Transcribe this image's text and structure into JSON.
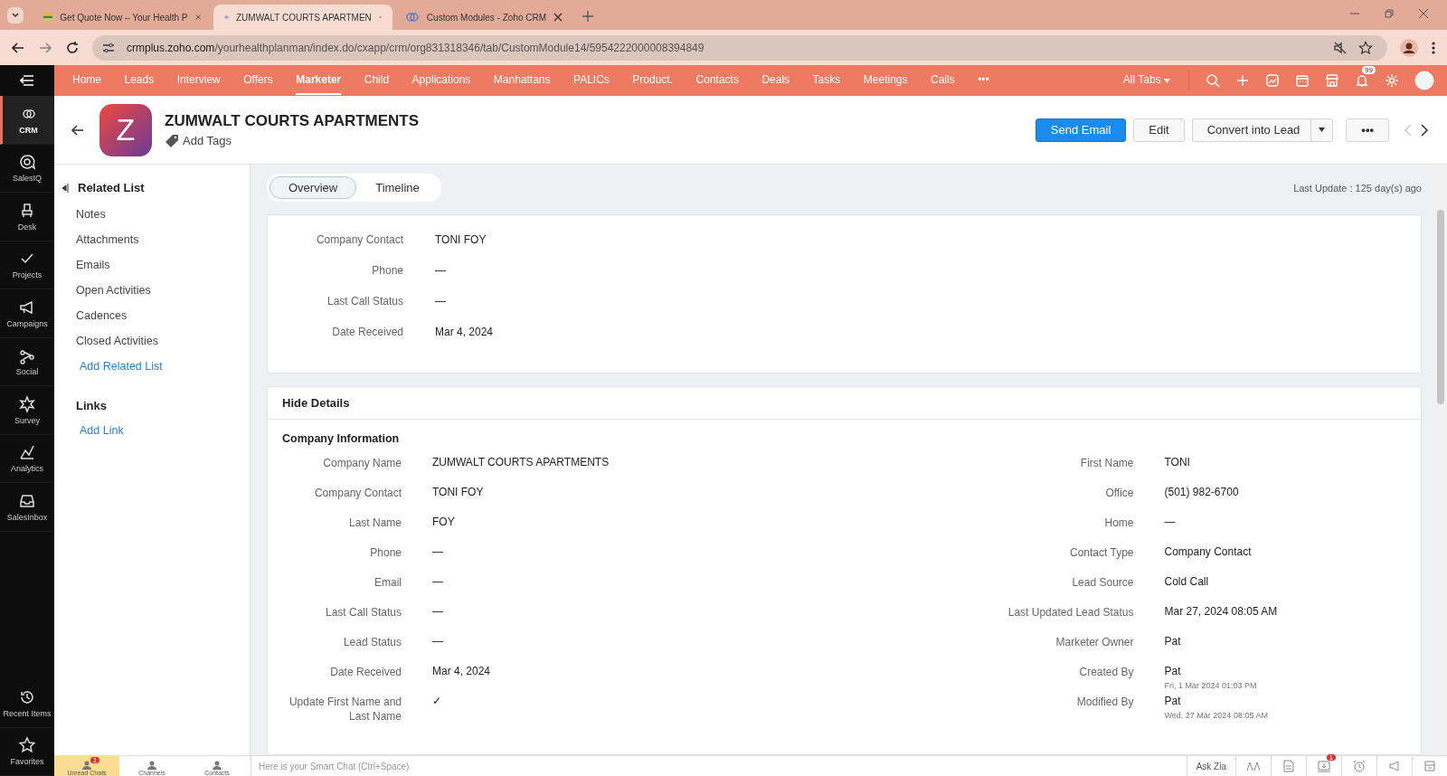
{
  "browser": {
    "tabs": [
      {
        "title": "Get Quote Now – Your Health P",
        "selected": false
      },
      {
        "title": "ZUMWALT COURTS APARTMEN",
        "selected": true
      },
      {
        "title": "Custom Modules - Zoho CRM",
        "selected": false
      }
    ],
    "url_host": "crmplus.zoho.com",
    "url_path": "/yourhealthplanman/index.do/cxapp/crm/org831318346/tab/CustomModule14/5954222000008394849"
  },
  "nav": {
    "items": [
      {
        "label": "Home",
        "selected": false
      },
      {
        "label": "Leads",
        "selected": false
      },
      {
        "label": "Interview",
        "selected": false
      },
      {
        "label": "Offers",
        "selected": false
      },
      {
        "label": "Marketer",
        "selected": true
      },
      {
        "label": "Child",
        "selected": false
      },
      {
        "label": "Applications",
        "selected": false
      },
      {
        "label": "Manhattans",
        "selected": false
      },
      {
        "label": "PALICs",
        "selected": false
      },
      {
        "label": "Product.",
        "selected": false
      },
      {
        "label": "Contacts",
        "selected": false
      },
      {
        "label": "Deals",
        "selected": false
      },
      {
        "label": "Tasks",
        "selected": false
      },
      {
        "label": "Meetings",
        "selected": false
      },
      {
        "label": "Calls",
        "selected": false
      }
    ],
    "more": "•••",
    "all_tabs": "All Tabs",
    "notification_count": "99"
  },
  "sidebar": {
    "items": [
      {
        "label": "CRM",
        "selected": true
      },
      {
        "label": "SalesIQ",
        "selected": false
      },
      {
        "label": "Desk",
        "selected": false
      },
      {
        "label": "Projects",
        "selected": false
      },
      {
        "label": "Campaigns",
        "selected": false
      },
      {
        "label": "Social",
        "selected": false
      },
      {
        "label": "Survey",
        "selected": false
      },
      {
        "label": "Analytics",
        "selected": false
      },
      {
        "label": "SalesInbox",
        "selected": false
      }
    ],
    "bottom_items": [
      {
        "label": "Recent Items"
      },
      {
        "label": "Favorites"
      }
    ]
  },
  "record": {
    "avatar_letter": "Z",
    "title": "ZUMWALT COURTS APARTMENTS",
    "add_tags": "Add Tags",
    "buttons": [
      {
        "label": "Send Email",
        "kind": "primary"
      },
      {
        "label": "Edit",
        "kind": "default"
      },
      {
        "label": "Convert into Lead",
        "kind": "split"
      },
      {
        "label": "•••",
        "kind": "default"
      }
    ]
  },
  "related": {
    "title": "Related List",
    "items": [
      "Notes",
      "Attachments",
      "Emails",
      "Open Activities",
      "Cadences",
      "Closed Activities"
    ],
    "add_related": "Add Related List",
    "links_title": "Links",
    "add_link": "Add Link"
  },
  "view_tabs": [
    {
      "label": "Overview",
      "selected": true
    },
    {
      "label": "Timeline",
      "selected": false
    }
  ],
  "last_update": "Last Update : 125 day(s) ago",
  "summary": [
    {
      "label": "Company Contact",
      "value": "TONI FOY"
    },
    {
      "label": "Phone",
      "value": "—"
    },
    {
      "label": "Last Call Status",
      "value": "—"
    },
    {
      "label": "Date Received",
      "value": "Mar 4, 2024"
    }
  ],
  "details": {
    "toggle": "Hide Details",
    "heading": "Company Information",
    "left": [
      {
        "label": "Company Name",
        "value": "ZUMWALT COURTS APARTMENTS"
      },
      {
        "label": "Company Contact",
        "value": "TONI FOY"
      },
      {
        "label": "Last Name",
        "value": "FOY"
      },
      {
        "label": "Phone",
        "value": "—"
      },
      {
        "label": "Email",
        "value": "—"
      },
      {
        "label": "Last Call Status",
        "value": "—"
      },
      {
        "label": "Lead Status",
        "value": "—"
      },
      {
        "label": "Date Received",
        "value": "Mar 4, 2024"
      },
      {
        "label": "Update First Name and Last Name",
        "value": "✓"
      }
    ],
    "right": [
      {
        "label": "First Name",
        "value": "TONI"
      },
      {
        "label": "Office",
        "value": "(501) 982-6700"
      },
      {
        "label": "Home",
        "value": "—"
      },
      {
        "label": "Contact Type",
        "value": "Company Contact"
      },
      {
        "label": "Lead Source",
        "value": "Cold Call"
      },
      {
        "label": "Last Updated Lead Status",
        "value": "Mar 27, 2024 08:05 AM"
      },
      {
        "label": "Marketer Owner",
        "value": "Pat"
      },
      {
        "label": "Created By",
        "value": "Pat",
        "sub": "Fri, 1 Mar 2024 01:03 PM"
      },
      {
        "label": "Modified By",
        "value": "Pat",
        "sub": "Wed, 27 Mar 2024 08:05 AM"
      }
    ]
  },
  "chat": {
    "tabs": [
      {
        "label": "Unread Chats",
        "badge": "1",
        "selected": true
      },
      {
        "label": "Channels",
        "selected": false
      },
      {
        "label": "Contacts",
        "selected": false
      }
    ],
    "placeholder": "Here is your Smart Chat (Ctrl+Space)",
    "ask_zia": "Ask Zia",
    "tray_badge": "1"
  }
}
